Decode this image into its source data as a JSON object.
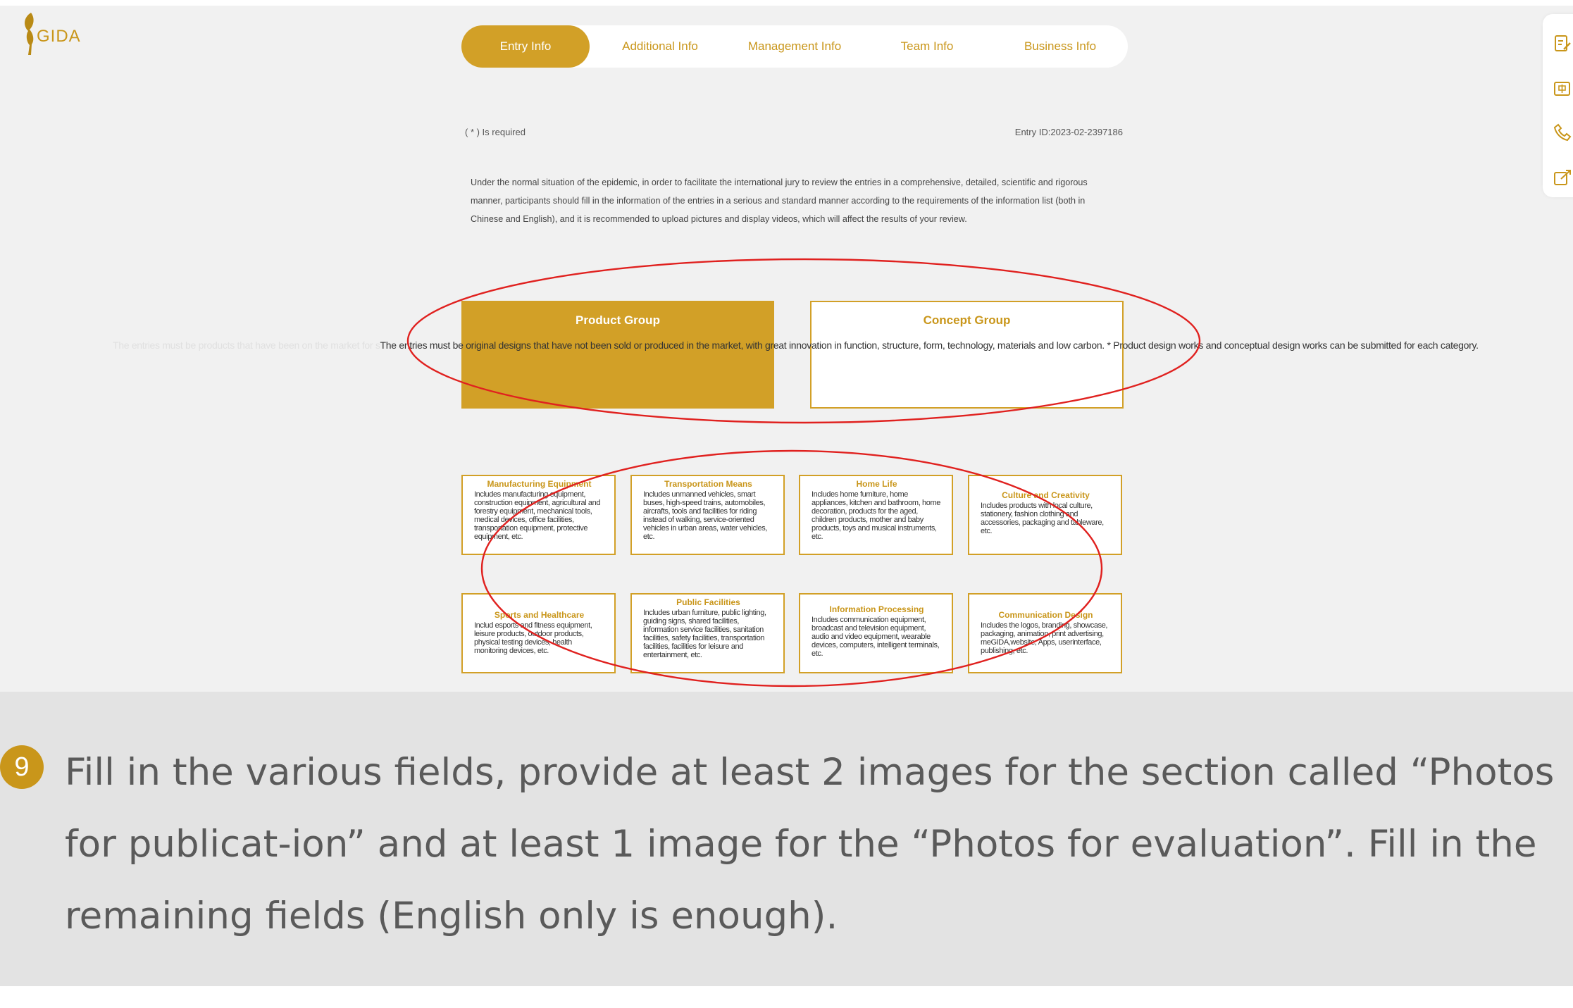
{
  "app": {
    "logo_text": "GIDA"
  },
  "tabs": [
    {
      "label": "Entry Info",
      "active": true
    },
    {
      "label": "Additional Info",
      "active": false
    },
    {
      "label": "Management Info",
      "active": false
    },
    {
      "label": "Team Info",
      "active": false
    },
    {
      "label": "Business Info",
      "active": false
    }
  ],
  "form": {
    "required_note": "( * ) Is required",
    "entry_id": "Entry ID:2023-02-2397186",
    "intro": "Under the normal situation of the epidemic, in order to facilitate the international jury to review the entries in a comprehensive, detailed, scientific and rigorous manner, participants should fill in the information of the entries in a serious and standard manner according to the requirements of the information list (both in Chinese and English), and it is recommended to upload pictures and display videos, which will affect the results of your review."
  },
  "groups": [
    {
      "label": "Product Group",
      "selected": true
    },
    {
      "label": "Concept Group",
      "selected": false
    }
  ],
  "group_description": {
    "faint": "The entries must be products that have been on the market for s",
    "main": "The entries must be original designs that have not been sold or produced in the market, with great innovation in function, structure, form, technology, materials and low carbon. * Product design works and conceptual design works can be submitted for each category."
  },
  "categories": [
    {
      "title": "Manufacturing Equipment",
      "desc": "Includes manufacturing equipment, construction equipment, agricultural and forestry equipment, mechanical tools, medical devices, office facilities, transportation equipment, protective equipment, etc."
    },
    {
      "title": "Transportation Means",
      "desc": "Includes unmanned vehicles, smart buses, high-speed trains, automobiles, aircrafts, tools and facilities for riding instead of walking, service-oriented vehicles in urban areas, water vehicles, etc."
    },
    {
      "title": "Home Life",
      "desc": "Includes home furniture, home appliances, kitchen and bathroom, home decoration, products for the aged, children products, mother and baby products, toys and musical instruments, etc."
    },
    {
      "title": "Culture and Creativity",
      "desc": "Includes products with local culture, stationery, fashion clothing and accessories, packaging and tableware, etc."
    },
    {
      "title": "Sports and Healthcare",
      "desc": "Includ esports and fitness equipment, leisure products, outdoor products, physical testing devices, health monitoring devices, etc."
    },
    {
      "title": "Public Facilities",
      "desc": "Includes urban furniture, public lighting, guiding signs, shared facilities, information service facilities, sanitation facilities, safety facilities, transportation facilities, facilities for leisure and entertainment, etc."
    },
    {
      "title": "Information Processing",
      "desc": "Includes communication equipment, broadcast and television equipment, audio and video equipment, wearable devices, computers, intelligent terminals, etc."
    },
    {
      "title": "Communication Design",
      "desc": "Includes the logos, branding, showcase, packaging, animation, print advertising, meGIDA,website, Apps, userinterface, publishing, etc."
    }
  ],
  "side_tools": [
    {
      "icon": "edit-form-icon"
    },
    {
      "icon": "language-icon"
    },
    {
      "icon": "phone-icon"
    },
    {
      "icon": "share-edit-icon"
    }
  ],
  "annotation": {
    "color": "#e0211f"
  },
  "instruction": {
    "step_number": "9",
    "text": "Fill in the various fields, provide at least 2 images for the section called “Photos for publicat-ion” and at least 1 image for the “Photos for evaluation”. Fill in the remaining fields (English only is enough)."
  },
  "colors": {
    "accent": "#d2a027",
    "accent_text": "#c9961a",
    "page_bg": "#f1f1f1",
    "instruction_bg": "#e3e3e3"
  }
}
